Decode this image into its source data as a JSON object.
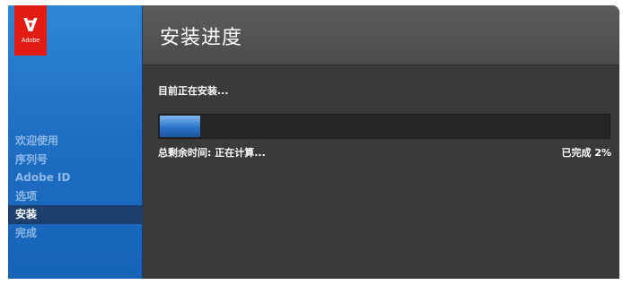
{
  "sidebar": {
    "logo_text": "Adobe",
    "items": [
      {
        "label": "欢迎使用"
      },
      {
        "label": "序列号"
      },
      {
        "label": "Adobe ID"
      },
      {
        "label": "选项"
      },
      {
        "label": "安装"
      },
      {
        "label": "完成"
      }
    ],
    "active_index": 4
  },
  "header": {
    "title": "安装进度"
  },
  "main": {
    "status": "目前正在安装...",
    "time_remaining": "总剩余时间: 正在计算...",
    "percent_label": "已完成 2%",
    "progress_fraction": 0.02
  },
  "colors": {
    "brand_red": "#e21b13",
    "sidebar_blue": "#1f6fc4",
    "active_item": "#1d3f6e",
    "progress_blue": "#2b74c9"
  },
  "icons": {
    "logo": "adobe-logo-icon"
  }
}
